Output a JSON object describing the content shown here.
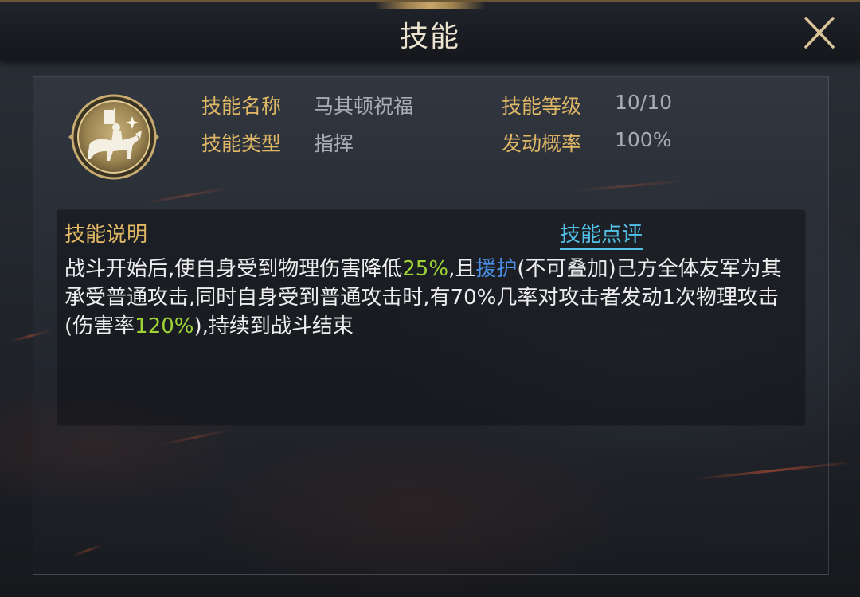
{
  "window": {
    "title": "技能",
    "close_icon": "close-x-icon"
  },
  "skill": {
    "icon": "cavalry-banner-medallion-icon",
    "fields": {
      "name_label": "技能名称",
      "name_value": "马其顿祝福",
      "type_label": "技能类型",
      "type_value": "指挥",
      "level_label": "技能等级",
      "level_value": "10/10",
      "chance_label": "发动概率",
      "chance_value": "100%"
    }
  },
  "description": {
    "title": "技能说明",
    "review_link": "技能点评",
    "segments": [
      {
        "text": "战斗开始后,使自身受到物理伤害降低",
        "style": "normal"
      },
      {
        "text": "25%",
        "style": "green"
      },
      {
        "text": ",且",
        "style": "normal"
      },
      {
        "text": "援护",
        "style": "link"
      },
      {
        "text": "(不可叠加)己方全体友军为其承受普通攻击,同时自身受到普通攻击时,有70%几率对攻击者发动1次物理攻击(伤害率",
        "style": "normal"
      },
      {
        "text": "120%",
        "style": "green"
      },
      {
        "text": "),持续到战斗结束",
        "style": "normal"
      }
    ]
  },
  "colors": {
    "label_gold": "#e0b865",
    "value_grey": "#a8acb3",
    "highlight_green": "#9ed436",
    "link_blue": "#4a8fe6",
    "review_cyan": "#52c2e8"
  }
}
